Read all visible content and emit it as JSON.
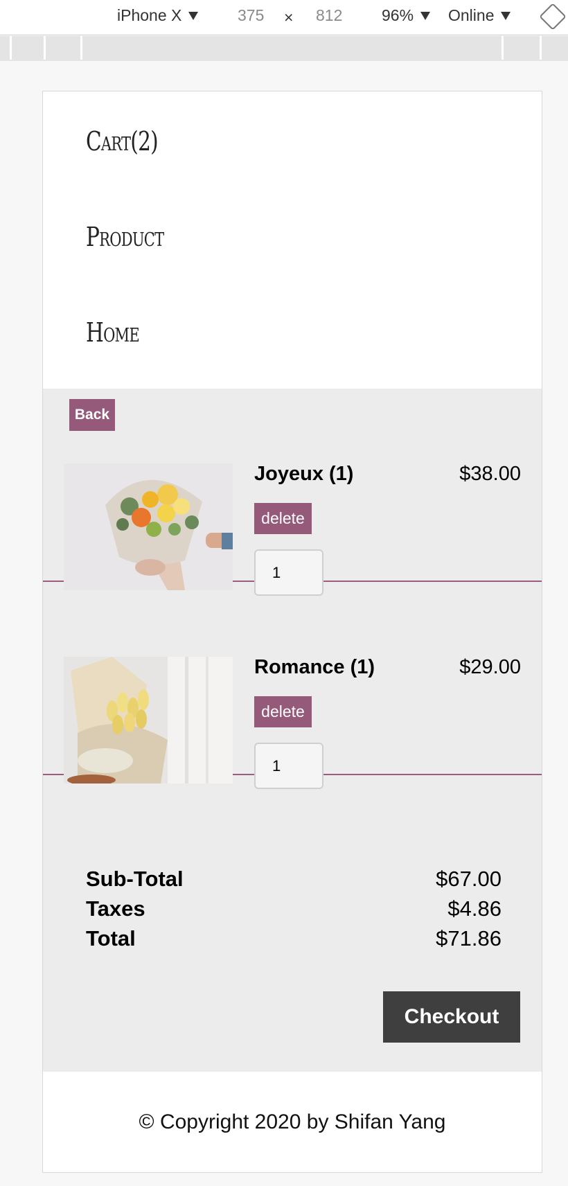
{
  "devtools": {
    "device": "iPhone X",
    "width": "375",
    "times": "×",
    "height": "812",
    "zoom": "96%",
    "network": "Online"
  },
  "nav": {
    "cart": "Cart(2)",
    "product": "Product",
    "home": "Home"
  },
  "cart": {
    "back_label": "Back",
    "delete_label": "delete",
    "items": [
      {
        "name": "Joyeux (1)",
        "price": "$38.00",
        "quantity": "1",
        "image_icon": "flower-bouquet-image"
      },
      {
        "name": "Romance (1)",
        "price": "$29.00",
        "quantity": "1",
        "image_icon": "tulip-bouquet-image"
      }
    ]
  },
  "summary": {
    "subtotal_label": "Sub-Total",
    "subtotal": "$67.00",
    "taxes_label": "Taxes",
    "taxes": "$4.86",
    "total_label": "Total",
    "total": "$71.86",
    "checkout_label": "Checkout"
  },
  "footer": {
    "copyright": "© Copyright 2020 by Shifan Yang"
  },
  "colors": {
    "accent": "#955a7a",
    "panel": "#ececec",
    "checkout": "#3f3f3f"
  }
}
